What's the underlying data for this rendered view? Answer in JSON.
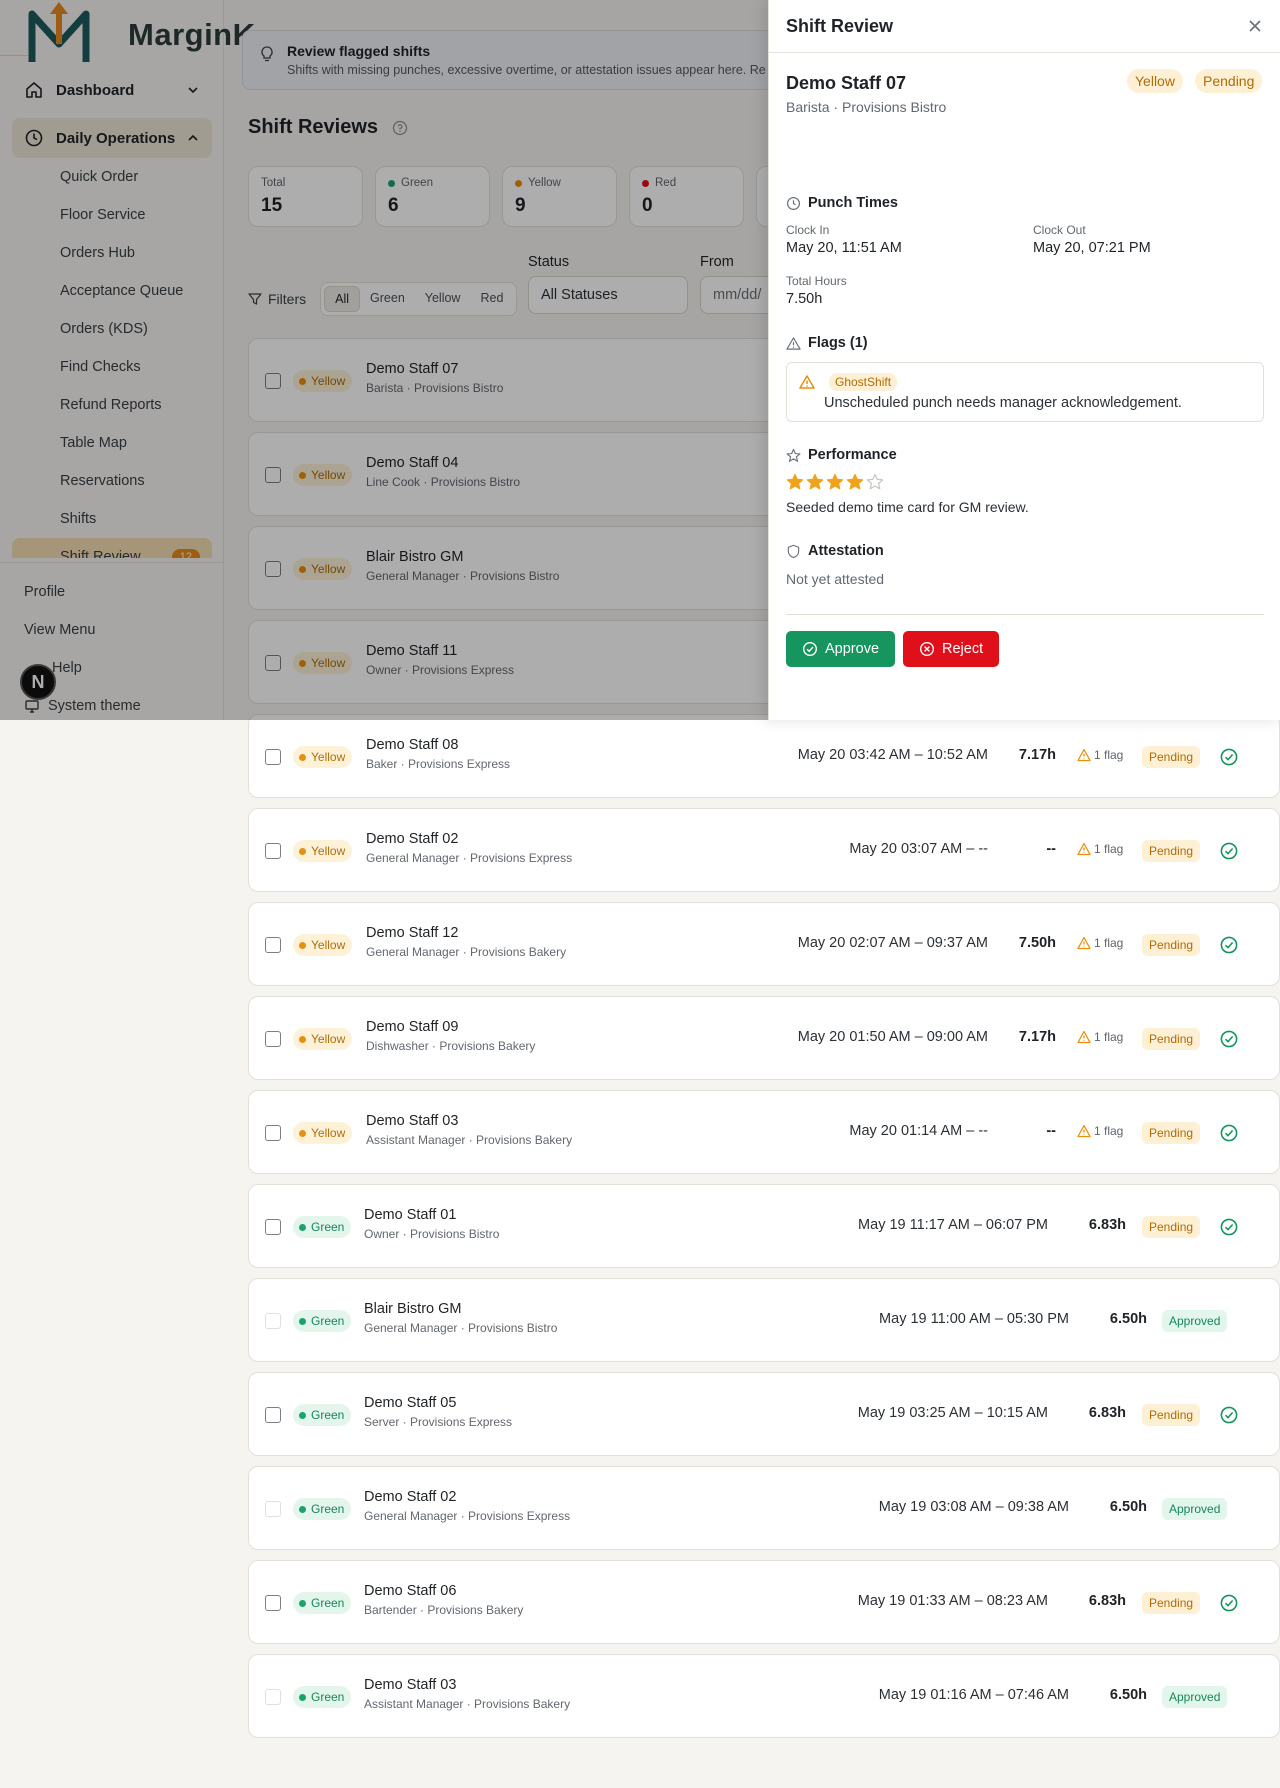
{
  "brand": {
    "name": "MarginK"
  },
  "sidebar": {
    "dashboard": "Dashboard",
    "daily_operations": "Daily Operations",
    "items": [
      "Quick Order",
      "Floor Service",
      "Orders Hub",
      "Acceptance Queue",
      "Orders (KDS)",
      "Find Checks",
      "Refund Reports",
      "Table Map",
      "Reservations",
      "Shifts",
      "Shift Review"
    ],
    "shift_review_count": "12",
    "footer": {
      "profile": "Profile",
      "view_menu": "View Menu",
      "help": "Help",
      "system_theme": "System theme"
    },
    "n_badge": "N"
  },
  "banner": {
    "title": "Review flagged shifts",
    "subtitle": "Shifts with missing punches, excessive overtime, or attestation issues appear here. Re"
  },
  "page": {
    "title": "Shift Reviews"
  },
  "stats": [
    {
      "label": "Total",
      "value": "15",
      "dot": ""
    },
    {
      "label": "Green",
      "value": "6",
      "dot": "#1aa36b"
    },
    {
      "label": "Yellow",
      "value": "9",
      "dot": "#e7900f"
    },
    {
      "label": "Red",
      "value": "0",
      "dot": "#e0101b"
    }
  ],
  "filters": {
    "label": "Filters",
    "segments": [
      "All",
      "Green",
      "Yellow",
      "Red"
    ],
    "active_segment": "All",
    "status_label": "Status",
    "status_value": "All Statuses",
    "from_label": "From",
    "from_placeholder": "mm/dd/"
  },
  "rows": [
    {
      "status": "Yellow",
      "name": "Demo Staff 07",
      "role": "Barista · Provisions Bistro",
      "times": "",
      "hours": "",
      "flag": "",
      "review": ""
    },
    {
      "status": "Yellow",
      "name": "Demo Staff 04",
      "role": "Line Cook · Provisions Bistro",
      "times": "",
      "hours": "",
      "flag": "",
      "review": ""
    },
    {
      "status": "Yellow",
      "name": "Blair Bistro GM",
      "role": "General Manager · Provisions Bistro",
      "times": "",
      "hours": "",
      "flag": "",
      "review": ""
    },
    {
      "status": "Yellow",
      "name": "Demo Staff 11",
      "role": "Owner · Provisions Express",
      "times": "",
      "hours": "",
      "flag": "",
      "review": ""
    },
    {
      "status": "Yellow",
      "name": "Demo Staff 08",
      "role": "Baker · Provisions Express",
      "times": "May 20 03:42 AM – 10:52 AM",
      "hours": "7.17h",
      "flag": "1 flag",
      "review": "Pending"
    },
    {
      "status": "Yellow",
      "name": "Demo Staff 02",
      "role": "General Manager · Provisions Express",
      "times": "May 20 03:07 AM – --",
      "hours": "--",
      "flag": "1 flag",
      "review": "Pending"
    },
    {
      "status": "Yellow",
      "name": "Demo Staff 12",
      "role": "General Manager · Provisions Bakery",
      "times": "May 20 02:07 AM – 09:37 AM",
      "hours": "7.50h",
      "flag": "1 flag",
      "review": "Pending"
    },
    {
      "status": "Yellow",
      "name": "Demo Staff 09",
      "role": "Dishwasher · Provisions Bakery",
      "times": "May 20 01:50 AM – 09:00 AM",
      "hours": "7.17h",
      "flag": "1 flag",
      "review": "Pending"
    },
    {
      "status": "Yellow",
      "name": "Demo Staff 03",
      "role": "Assistant Manager · Provisions Bakery",
      "times": "May 20 01:14 AM – --",
      "hours": "--",
      "flag": "1 flag",
      "review": "Pending"
    },
    {
      "status": "Green",
      "name": "Demo Staff 01",
      "role": "Owner · Provisions Bistro",
      "times": "May 19 11:17 AM – 06:07 PM",
      "hours": "6.83h",
      "flag": "",
      "review": "Pending"
    },
    {
      "status": "Green",
      "name": "Blair Bistro GM",
      "role": "General Manager · Provisions Bistro",
      "times": "May 19 11:00 AM – 05:30 PM",
      "hours": "6.50h",
      "flag": "",
      "review": "Approved"
    },
    {
      "status": "Green",
      "name": "Demo Staff 05",
      "role": "Server · Provisions Express",
      "times": "May 19 03:25 AM – 10:15 AM",
      "hours": "6.83h",
      "flag": "",
      "review": "Pending"
    },
    {
      "status": "Green",
      "name": "Demo Staff 02",
      "role": "General Manager · Provisions Express",
      "times": "May 19 03:08 AM – 09:38 AM",
      "hours": "6.50h",
      "flag": "",
      "review": "Approved"
    },
    {
      "status": "Green",
      "name": "Demo Staff 06",
      "role": "Bartender · Provisions Bakery",
      "times": "May 19 01:33 AM – 08:23 AM",
      "hours": "6.83h",
      "flag": "",
      "review": "Pending"
    },
    {
      "status": "Green",
      "name": "Demo Staff 03",
      "role": "Assistant Manager · Provisions Bakery",
      "times": "May 19 01:16 AM – 07:46 AM",
      "hours": "6.50h",
      "flag": "",
      "review": "Approved"
    }
  ],
  "drawer": {
    "title": "Shift Review",
    "employee_name": "Demo Staff 07",
    "employee_role": "Barista · Provisions Bistro",
    "tag_status": "Yellow",
    "tag_review": "Pending",
    "punch_heading": "Punch Times",
    "clock_in_label": "Clock In",
    "clock_in_value": "May 20, 11:51 AM",
    "clock_out_label": "Clock Out",
    "clock_out_value": "May 20, 07:21 PM",
    "total_hours_label": "Total Hours",
    "total_hours_value": "7.50h",
    "flags_heading": "Flags (1)",
    "flag_type": "GhostShift",
    "flag_description": "Unscheduled punch needs manager acknowledgement.",
    "performance_heading": "Performance",
    "rating": 4,
    "rating_max": 5,
    "performance_note": "Seeded demo time card for GM review.",
    "attestation_heading": "Attestation",
    "attestation_value": "Not yet attested",
    "approve_label": "Approve",
    "reject_label": "Reject"
  },
  "colors": {
    "accent": "#e8891c",
    "green": "#17955e",
    "red": "#e0101b",
    "yellow": "#e7900f"
  }
}
